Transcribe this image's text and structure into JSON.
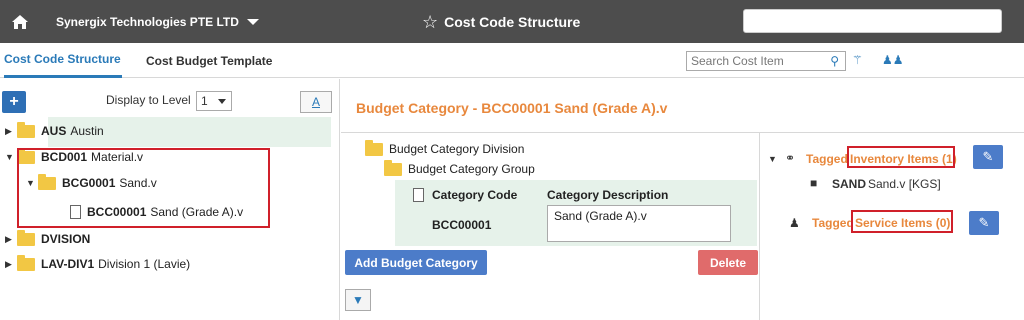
{
  "topbar": {
    "company": "Synergix Technologies PTE LTD",
    "app_title": "Cost Code Structure",
    "search_value": ""
  },
  "tabs": [
    {
      "label": "Cost Code Structure",
      "active": true
    },
    {
      "label": "Cost Budget Template",
      "active": false
    }
  ],
  "search_cost": {
    "placeholder": "Search Cost Item"
  },
  "left": {
    "display_level_label": "Display to Level",
    "level_value": "1",
    "a_button": "A",
    "tree": [
      {
        "code": "AUS",
        "name": "Austin"
      },
      {
        "code": "BCD001",
        "name": "Material.v"
      },
      {
        "code": "BCG0001",
        "name": "Sand.v"
      },
      {
        "code": "BCC00001",
        "name": "Sand (Grade A).v"
      },
      {
        "code": "DVISION",
        "name": ""
      },
      {
        "code": "LAV-DIV1",
        "name": "Division 1 (Lavie)"
      }
    ]
  },
  "middle": {
    "title": "Budget Category - BCC00001 Sand (Grade A).v",
    "division": "Budget Category Division",
    "group": "Budget Category Group",
    "code_label": "Category Code",
    "desc_label": "Category Description",
    "code_value": "BCC00001",
    "desc_value": "Sand (Grade A).v",
    "add_button": "Add Budget Category",
    "delete_button": "Delete"
  },
  "right": {
    "tagged_inventory_prefix": "Tagged",
    "tagged_inventory_label": "Inventory Items (1)",
    "inventory_item_code": "SAND",
    "inventory_item_name": "Sand.v [KGS]",
    "tagged_service_prefix": "Tagged",
    "tagged_service_label": "Service Items (0)"
  }
}
